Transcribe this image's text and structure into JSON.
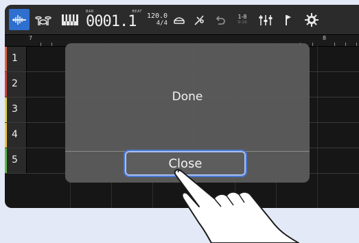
{
  "toolbar": {
    "counter_label_left": "BAR",
    "counter_label_right": "BEAT",
    "counter_value": "0001.1",
    "tempo": "120.0",
    "time_signature": "4/4",
    "track_select_top": "1-8",
    "track_select_bottom": "9-16",
    "icons": [
      "track-view-icon",
      "drum-kit-icon",
      "piano-keys-icon",
      "record-target-icon",
      "effects-icon",
      "undo-icon",
      "mixer-icon",
      "marker-icon",
      "settings-gear-icon"
    ]
  },
  "ruler": {
    "marks": [
      "7",
      "8"
    ]
  },
  "tracks": [
    {
      "number": "1",
      "color": "#e0643c"
    },
    {
      "number": "2",
      "color": "#d0423c"
    },
    {
      "number": "3",
      "color": "#e0d440"
    },
    {
      "number": "4",
      "color": "#f0c23c"
    },
    {
      "number": "5",
      "color": "#5fb84a"
    }
  ],
  "dialog": {
    "message": "Done",
    "button_label": "Close"
  },
  "colors": {
    "accent": "#2e6fcf",
    "focus_ring": "#4a78d6"
  }
}
